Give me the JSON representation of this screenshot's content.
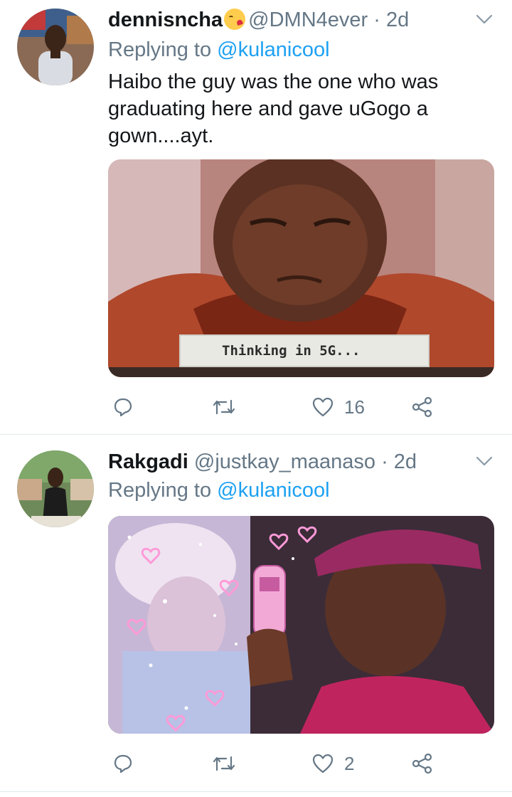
{
  "tweets": [
    {
      "display_name": "dennisncha",
      "name_emoji": "kissing-heart-emoji",
      "handle": "@DMN4ever",
      "time": "· 2d",
      "replying_prefix": "Replying to",
      "replying_to": "@kulanicool",
      "text": "Haibo the guy was the one who was graduating here and gave uGogo a gown....ayt.",
      "media_caption": "Thinking in 5G...",
      "actions": {
        "reply_count": "",
        "retweet_count": "",
        "like_count": "16"
      }
    },
    {
      "display_name": "Rakgadi",
      "handle": "@justkay_maanaso",
      "time": "· 2d",
      "replying_prefix": "Replying to",
      "replying_to": "@kulanicool",
      "text": "",
      "actions": {
        "reply_count": "",
        "retweet_count": "",
        "like_count": "2"
      }
    }
  ],
  "colors": {
    "link": "#1da1f2",
    "secondary": "#657786",
    "divider": "#e1e8ed"
  }
}
